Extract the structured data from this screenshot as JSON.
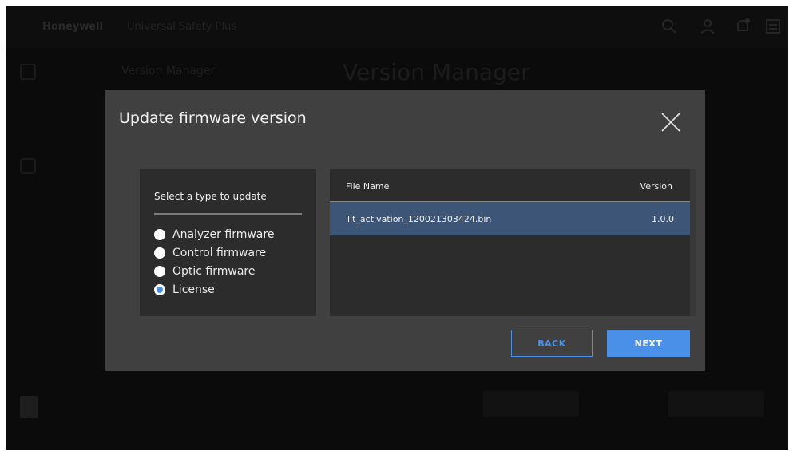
{
  "background": {
    "brand": "Honeywell",
    "app_title": "Universal Safety Plus",
    "breadcrumb": "Version Manager",
    "page_title": "Version Manager"
  },
  "dialog": {
    "title": "Update firmware version",
    "type_panel": {
      "heading": "Select a type to update",
      "options": [
        {
          "label": "Analyzer firmware",
          "selected": false
        },
        {
          "label": "Control firmware",
          "selected": false
        },
        {
          "label": "Optic firmware",
          "selected": false
        },
        {
          "label": "License",
          "selected": true
        }
      ]
    },
    "file_table": {
      "columns": [
        "File Name",
        "Version"
      ],
      "rows": [
        {
          "file_name": "lit_activation_120021303424.bin",
          "version": "1.0.0",
          "selected": true
        }
      ]
    },
    "back_label": "BACK",
    "next_label": "NEXT"
  },
  "colors": {
    "accent": "#4a90e8",
    "selected_row": "#3d5678",
    "modal_bg": "#404040",
    "panel_bg": "#2c2c2c"
  }
}
